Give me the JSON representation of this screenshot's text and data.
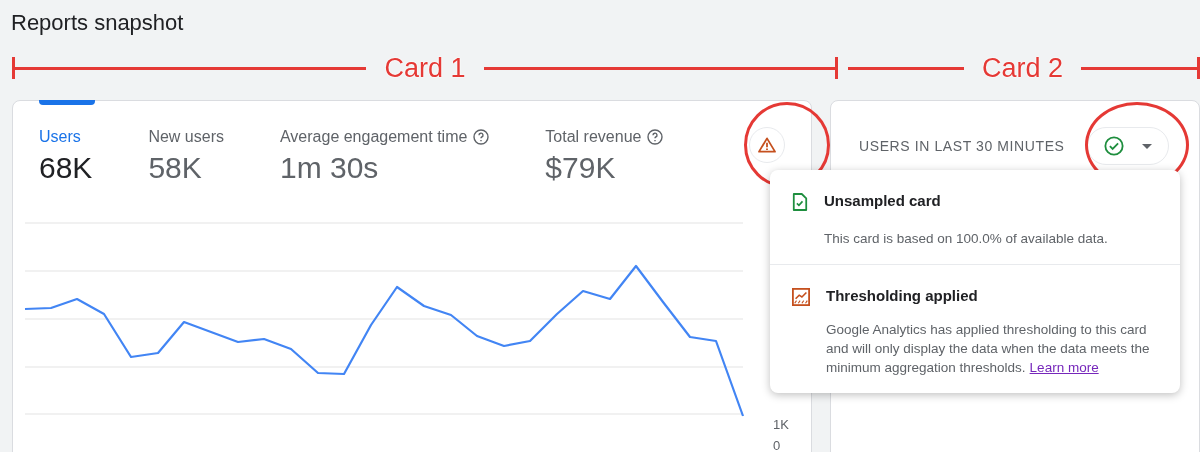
{
  "page": {
    "title": "Reports snapshot"
  },
  "annotations": [
    {
      "label": "Card 1"
    },
    {
      "label": "Card 2"
    }
  ],
  "card_1": {
    "metrics": [
      {
        "label": "Users",
        "value": "68K",
        "selected": true,
        "help": false
      },
      {
        "label": "New users",
        "value": "58K",
        "selected": false,
        "help": false
      },
      {
        "label": "Average engagement time",
        "value": "1m 30s",
        "selected": false,
        "help": true
      },
      {
        "label": "Total revenue",
        "value": "$79K",
        "selected": false,
        "help": true
      }
    ],
    "axis_labels": [
      "1K",
      "0"
    ]
  },
  "card_2": {
    "title": "USERS IN LAST 30 MINUTES"
  },
  "popup": {
    "items": [
      {
        "kind": "unsampled",
        "title": "Unsampled card",
        "text": "This card is based on 100.0% of available data."
      },
      {
        "kind": "thresholding",
        "title": "Thresholding applied",
        "text": "Google Analytics has applied thresholding to this card and will only display the data when the data meets the minimum aggregation thresholds.",
        "link": "Learn more"
      }
    ]
  }
}
